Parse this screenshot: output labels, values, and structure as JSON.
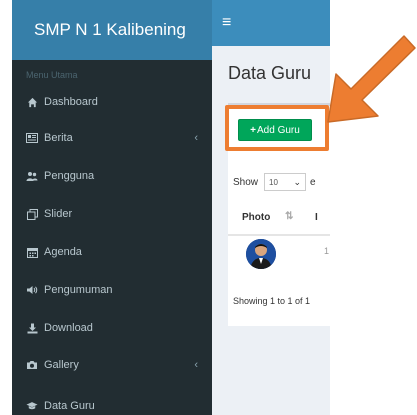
{
  "brand": {
    "title": "SMP N 1 Kalibening"
  },
  "sidebar": {
    "menu_header": "Menu Utama",
    "items": [
      {
        "label": "Dashboard",
        "icon": "home-icon"
      },
      {
        "label": "Berita",
        "icon": "newspaper-icon",
        "has_submenu": true
      },
      {
        "label": "Pengguna",
        "icon": "users-icon"
      },
      {
        "label": "Slider",
        "icon": "clone-icon"
      },
      {
        "label": "Agenda",
        "icon": "calendar-icon"
      },
      {
        "label": "Pengumuman",
        "icon": "volume-icon"
      },
      {
        "label": "Download",
        "icon": "download-icon"
      },
      {
        "label": "Gallery",
        "icon": "camera-icon",
        "has_submenu": true
      },
      {
        "label": "Data Guru",
        "icon": "graduation-cap-icon"
      }
    ]
  },
  "topbar": {
    "toggle_icon": "hamburger-icon"
  },
  "main": {
    "page_title": "Data Guru",
    "add_button": {
      "icon": "+",
      "label": "Add Guru"
    },
    "show_label": "Show",
    "page_length": "10",
    "entries_partial": "e",
    "table": {
      "columns": [
        "Photo",
        "I"
      ],
      "rows": [
        {
          "cell_partial": "1"
        }
      ]
    },
    "info_text": "Showing 1 to 1 of 1"
  },
  "colors": {
    "sidebar_bg": "#222d32",
    "brand_bg": "#367fa9",
    "topbar_bg": "#3c8dbc",
    "add_button_bg": "#00a65a",
    "annotation_orange": "#ed7d31"
  }
}
